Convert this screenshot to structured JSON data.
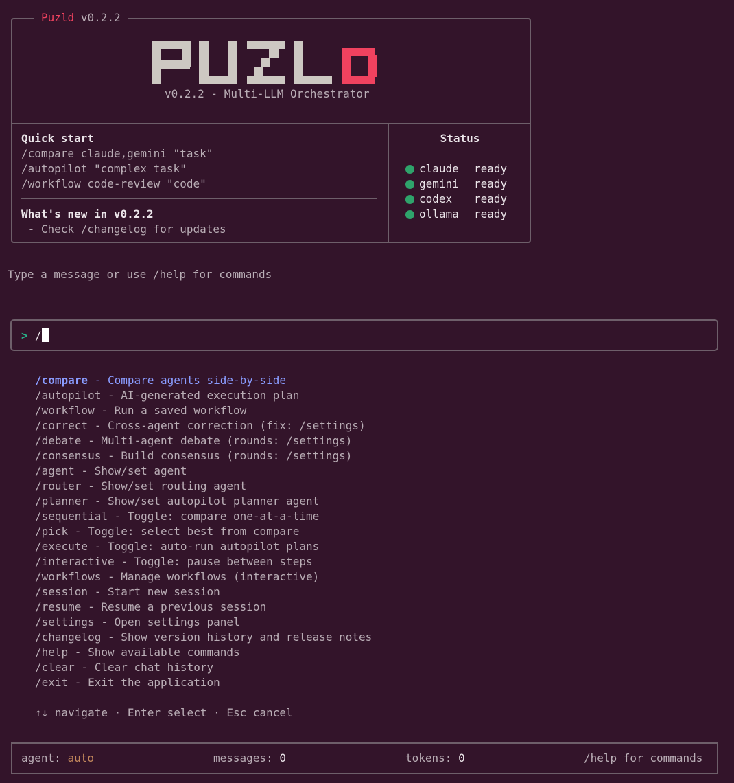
{
  "header": {
    "app_name": "Puzld",
    "version": "v0.2.2",
    "logo_text": "PUZLD",
    "tagline": "v0.2.2 - Multi-LLM Orchestrator"
  },
  "quick_start": {
    "title": "Quick start",
    "lines": [
      "/compare claude,gemini \"task\"",
      "/autopilot \"complex task\"",
      "/workflow code-review \"code\""
    ]
  },
  "whats_new": {
    "title": "What's new in v0.2.2",
    "line": " - Check /changelog for updates"
  },
  "status": {
    "title": "Status",
    "agents": [
      {
        "name": "claude",
        "state": "ready"
      },
      {
        "name": "gemini",
        "state": "ready"
      },
      {
        "name": "codex",
        "state": "ready"
      },
      {
        "name": "ollama",
        "state": "ready"
      }
    ],
    "ready_color": "#2fa36b"
  },
  "hint": "Type a message or use /help for commands",
  "input": {
    "prompt": ">",
    "value": "/"
  },
  "commands": [
    {
      "cmd": "/compare",
      "desc": "Compare agents side-by-side",
      "selected": true
    },
    {
      "cmd": "/autopilot",
      "desc": "AI-generated execution plan"
    },
    {
      "cmd": "/workflow",
      "desc": "Run a saved workflow"
    },
    {
      "cmd": "/correct",
      "desc": "Cross-agent correction (fix: /settings)"
    },
    {
      "cmd": "/debate",
      "desc": "Multi-agent debate (rounds: /settings)"
    },
    {
      "cmd": "/consensus",
      "desc": "Build consensus (rounds: /settings)"
    },
    {
      "cmd": "/agent",
      "desc": "Show/set agent"
    },
    {
      "cmd": "/router",
      "desc": "Show/set routing agent"
    },
    {
      "cmd": "/planner",
      "desc": "Show/set autopilot planner agent"
    },
    {
      "cmd": "/sequential",
      "desc": "Toggle: compare one-at-a-time"
    },
    {
      "cmd": "/pick",
      "desc": "Toggle: select best from compare"
    },
    {
      "cmd": "/execute",
      "desc": "Toggle: auto-run autopilot plans"
    },
    {
      "cmd": "/interactive",
      "desc": "Toggle: pause between steps"
    },
    {
      "cmd": "/workflows",
      "desc": "Manage workflows (interactive)"
    },
    {
      "cmd": "/session",
      "desc": "Start new session"
    },
    {
      "cmd": "/resume",
      "desc": "Resume a previous session"
    },
    {
      "cmd": "/settings",
      "desc": "Open settings panel"
    },
    {
      "cmd": "/changelog",
      "desc": "Show version history and release notes"
    },
    {
      "cmd": "/help",
      "desc": "Show available commands"
    },
    {
      "cmd": "/clear",
      "desc": "Clear chat history"
    },
    {
      "cmd": "/exit",
      "desc": "Exit the application"
    }
  ],
  "nav_hint": "↑↓ navigate · Enter select · Esc cancel",
  "footer": {
    "agent_label": "agent:",
    "agent_value": "auto",
    "messages_label": "messages:",
    "messages_value": "0",
    "tokens_label": "tokens:",
    "tokens_value": "0",
    "help": "/help for commands"
  },
  "colors": {
    "background": "#33142a",
    "accent_red": "#f0425f",
    "selected_blue": "#8a9cff",
    "prompt_green": "#28b38a",
    "agent_orange": "#c2875c"
  }
}
